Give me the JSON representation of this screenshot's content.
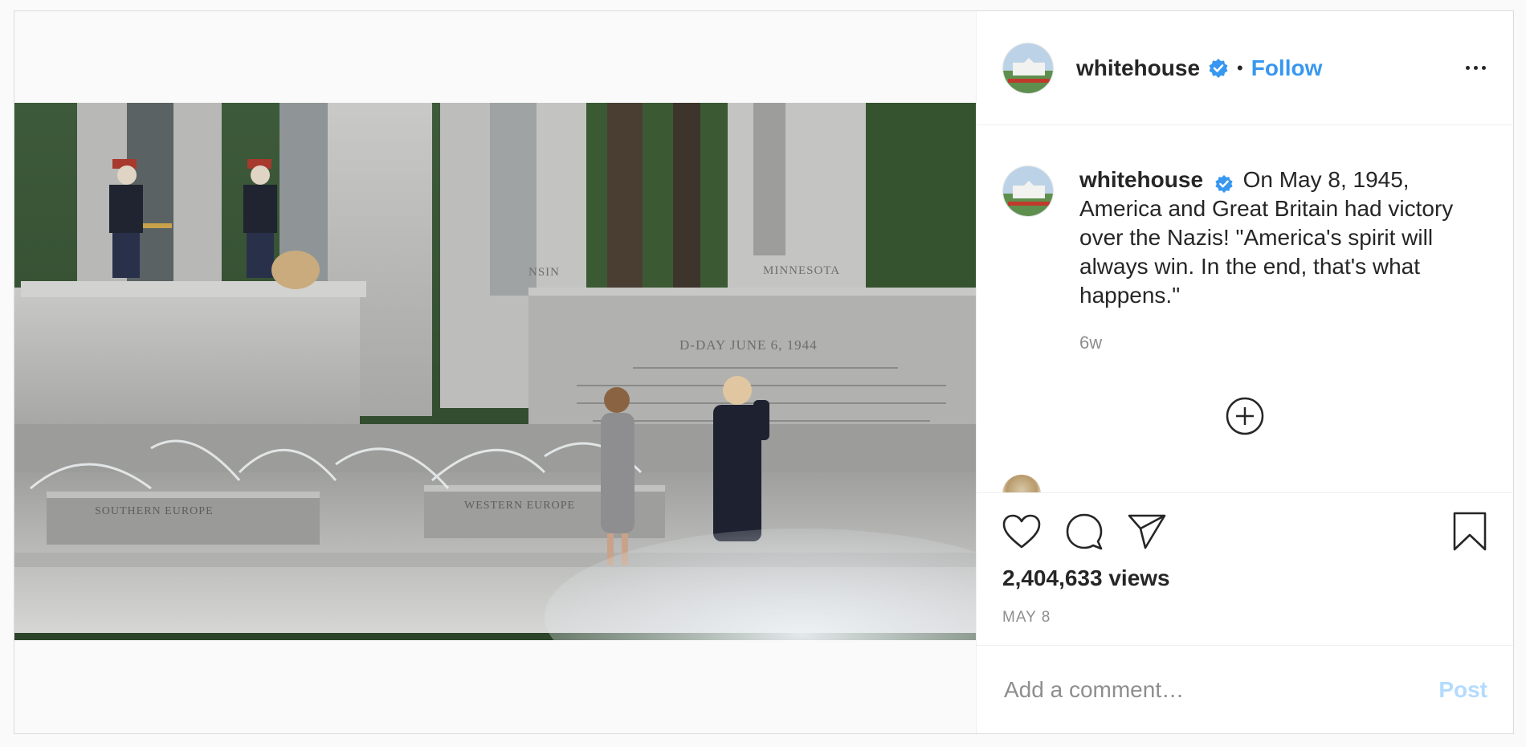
{
  "header": {
    "username": "whitehouse",
    "separator": "•",
    "follow_label": "Follow",
    "verified_icon": "verified-badge-icon",
    "more_icon": "more-options-icon"
  },
  "media": {
    "engraving_title": "D-DAY   JUNE 6, 1944",
    "pillar_label_left": "NSIN",
    "pillar_label_right": "MINNESOTA",
    "base_label_left": "SOUTHERN EUROPE",
    "base_label_right": "WESTERN EUROPE"
  },
  "caption": {
    "username": "whitehouse",
    "text": "On May 8, 1945, America and Great Britain had victory over the Nazis! \"America's spirit will always win. In the end, that's what happens.\"",
    "time_ago": "6w"
  },
  "actions": {
    "like_icon": "heart-icon",
    "comment_icon": "comment-icon",
    "share_icon": "share-icon",
    "save_icon": "bookmark-icon",
    "views": "2,404,633 views",
    "date": "MAY 8"
  },
  "comment_box": {
    "placeholder": "Add a comment…",
    "post_label": "Post"
  },
  "colors": {
    "accent": "#3897f0",
    "post_disabled": "#b3dbff",
    "text": "#262626",
    "muted": "#8e8e8e"
  }
}
